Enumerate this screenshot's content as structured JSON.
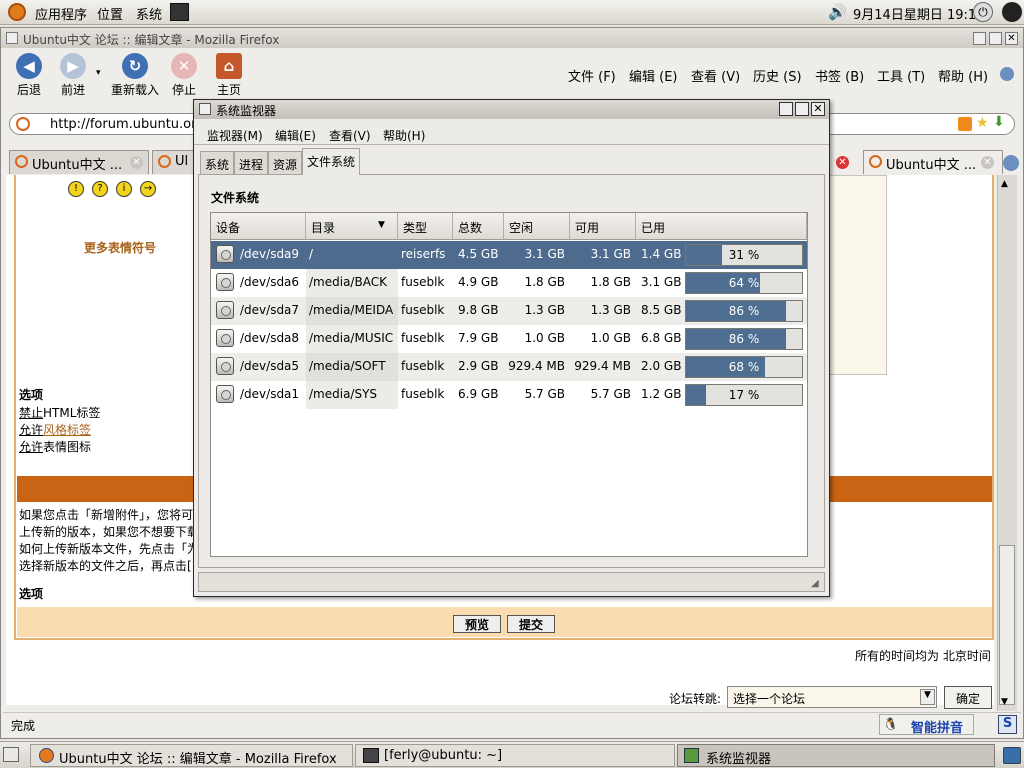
{
  "top_panel": {
    "apps": "应用程序",
    "places": "位置",
    "system": "系统",
    "clock": "9月14日星期日 19:16"
  },
  "firefox": {
    "title": "Ubuntu中文 论坛 :: 编辑文章 - Mozilla Firefox",
    "toolbar": {
      "back": "后退",
      "forward": "前进",
      "reload": "重新载入",
      "stop": "停止",
      "home": "主页"
    },
    "menu": [
      "文件 (F)",
      "编辑 (E)",
      "查看 (V)",
      "历史 (S)",
      "书签 (B)",
      "工具 (T)",
      "帮助 (H)"
    ],
    "url": "http://forum.ubuntu.org",
    "tabs": [
      "Ubuntu中文 ...",
      "Ul",
      "Ubuntu中文 ..."
    ],
    "page": {
      "more_emoticons": "更多表情符号",
      "options_title": "选项",
      "opt1_pre": "禁止",
      "opt1": "HTML标签",
      "opt2_pre": "允许",
      "opt2": "风格标签",
      "opt3_pre": "允许",
      "opt3": "表情图标",
      "help_lines": [
        "如果您点击「新增附件」，您将可",
        "上传新的版本，如果您不想要下载",
        "如何上传新版本文件，先点击「为",
        "选择新版本的文件之后，再点击["
      ],
      "options2": "选项",
      "btn1": "预览",
      "btn2": "提交",
      "timezone": "所有的时间均为 北京时间",
      "jump_label": "论坛转跳:",
      "jump_select": "选择一个论坛",
      "jump_go": "确定"
    },
    "status": "完成",
    "ime": "智能拼音"
  },
  "sysmon": {
    "title": "系统监视器",
    "menu": [
      "监视器(M)",
      "编辑(E)",
      "查看(V)",
      "帮助(H)"
    ],
    "tabs": [
      "系统",
      "进程",
      "资源",
      "文件系统"
    ],
    "section": "文件系统",
    "columns": [
      "设备",
      "目录",
      "类型",
      "总数",
      "空闲",
      "可用",
      "已用"
    ],
    "rows": [
      {
        "device": "/dev/sda9",
        "dir": "/",
        "type": "reiserfs",
        "total": "4.5 GB",
        "free": "3.1 GB",
        "avail": "3.1 GB",
        "used": "1.4 GB",
        "pct_label": "31 %",
        "pct": 31
      },
      {
        "device": "/dev/sda6",
        "dir": "/media/BACK",
        "type": "fuseblk",
        "total": "4.9 GB",
        "free": "1.8 GB",
        "avail": "1.8 GB",
        "used": "3.1 GB",
        "pct_label": "64 %",
        "pct": 64
      },
      {
        "device": "/dev/sda7",
        "dir": "/media/MEIDA",
        "type": "fuseblk",
        "total": "9.8 GB",
        "free": "1.3 GB",
        "avail": "1.3 GB",
        "used": "8.5 GB",
        "pct_label": "86 %",
        "pct": 86
      },
      {
        "device": "/dev/sda8",
        "dir": "/media/MUSIC",
        "type": "fuseblk",
        "total": "7.9 GB",
        "free": "1.0 GB",
        "avail": "1.0 GB",
        "used": "6.8 GB",
        "pct_label": "86 %",
        "pct": 86
      },
      {
        "device": "/dev/sda5",
        "dir": "/media/SOFT",
        "type": "fuseblk",
        "total": "2.9 GB",
        "free": "929.4 MB",
        "avail": "929.4 MB",
        "used": "2.0 GB",
        "pct_label": "68 %",
        "pct": 68
      },
      {
        "device": "/dev/sda1",
        "dir": "/media/SYS",
        "type": "fuseblk",
        "total": "6.9 GB",
        "free": "5.7 GB",
        "avail": "5.7 GB",
        "used": "1.2 GB",
        "pct_label": "17 %",
        "pct": 17
      }
    ]
  },
  "taskbar": [
    "Ubuntu中文 论坛 :: 编辑文章 - Mozilla Firefox",
    "[ferly@ubuntu: ~]",
    "系统监视器"
  ],
  "colors": {
    "accent": "#4e6e92",
    "selected_row": "#4e6b8e",
    "orange": "#c86414"
  }
}
